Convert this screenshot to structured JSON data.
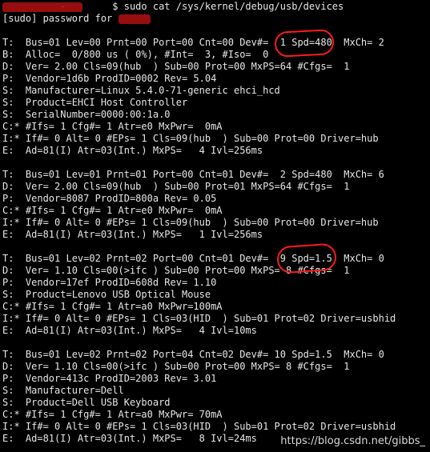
{
  "terminal": {
    "lines": [
      "          -        $ sudo cat /sys/kernel/debug/usb/devices",
      "[sudo] password for ",
      "",
      "T:  Bus=01 Lev=00 Prnt=00 Port=00 Cnt=00 Dev#=  1 Spd=480  MxCh= 2",
      "B:  Alloc=  0/800 us ( 0%), #Int=  3, #Iso=  0",
      "D:  Ver= 2.00 Cls=09(hub  ) Sub=00 Prot=00 MxPS=64 #Cfgs=  1",
      "P:  Vendor=1d6b ProdID=0002 Rev= 5.04",
      "S:  Manufacturer=Linux 5.4.0-71-generic ehci_hcd",
      "S:  Product=EHCI Host Controller",
      "S:  SerialNumber=0000:00:1a.0",
      "C:* #Ifs= 1 Cfg#= 1 Atr=e0 MxPwr=  0mA",
      "I:* If#= 0 Alt= 0 #EPs= 1 Cls=09(hub  ) Sub=00 Prot=00 Driver=hub",
      "E:  Ad=81(I) Atr=03(Int.) MxPS=   4 Ivl=256ms",
      "",
      "T:  Bus=01 Lev=01 Prnt=01 Port=00 Cnt=01 Dev#=  2 Spd=480  MxCh= 6",
      "D:  Ver= 2.00 Cls=09(hub  ) Sub=00 Prot=01 MxPS=64 #Cfgs=  1",
      "P:  Vendor=8087 ProdID=800a Rev= 0.05",
      "C:* #Ifs= 1 Cfg#= 1 Atr=e0 MxPwr=  0mA",
      "I:* If#= 0 Alt= 0 #EPs= 1 Cls=09(hub  ) Sub=00 Prot=00 Driver=hub",
      "E:  Ad=81(I) Atr=03(Int.) MxPS=   1 Ivl=256ms",
      "",
      "T:  Bus=01 Lev=02 Prnt=02 Port=00 Cnt=01 Dev#=  9 Spd=1.5  MxCh= 0",
      "D:  Ver= 1.10 Cls=00(>ifc ) Sub=00 Prot=00 MxPS= 8 #Cfgs=  1",
      "P:  Vendor=17ef ProdID=608d Rev= 1.10",
      "S:  Product=Lenovo USB Optical Mouse",
      "C:* #Ifs= 1 Cfg#= 1 Atr=a0 MxPwr=100mA",
      "I:* If#= 0 Alt= 0 #EPs= 1 Cls=03(HID  ) Sub=01 Prot=02 Driver=usbhid",
      "E:  Ad=81(I) Atr=03(Int.) MxPS=   4 Ivl=10ms",
      "",
      "T:  Bus=01 Lev=02 Prnt=02 Port=04 Cnt=02 Dev#= 10 Spd=1.5  MxCh= 0",
      "D:  Ver= 1.10 Cls=00(>ifc ) Sub=00 Prot=00 MxPS= 8 #Cfgs=  1",
      "P:  Vendor=413c ProdID=2003 Rev= 3.01",
      "S:  Manufacturer=Dell",
      "S:  Product=Dell USB Keyboard",
      "C:* #Ifs= 1 Cfg#= 1 Atr=a0 MxPwr= 70mA",
      "I:* If#= 0 Alt= 0 #EPs= 1 Cls=03(HID  ) Sub=01 Prot=02 Driver=usbhid",
      "E:  Ad=81(I) Atr=03(Int.) MxPS=   8 Ivl=24ms"
    ],
    "watermark": "https://blog.csdn.net/gibbs_"
  }
}
